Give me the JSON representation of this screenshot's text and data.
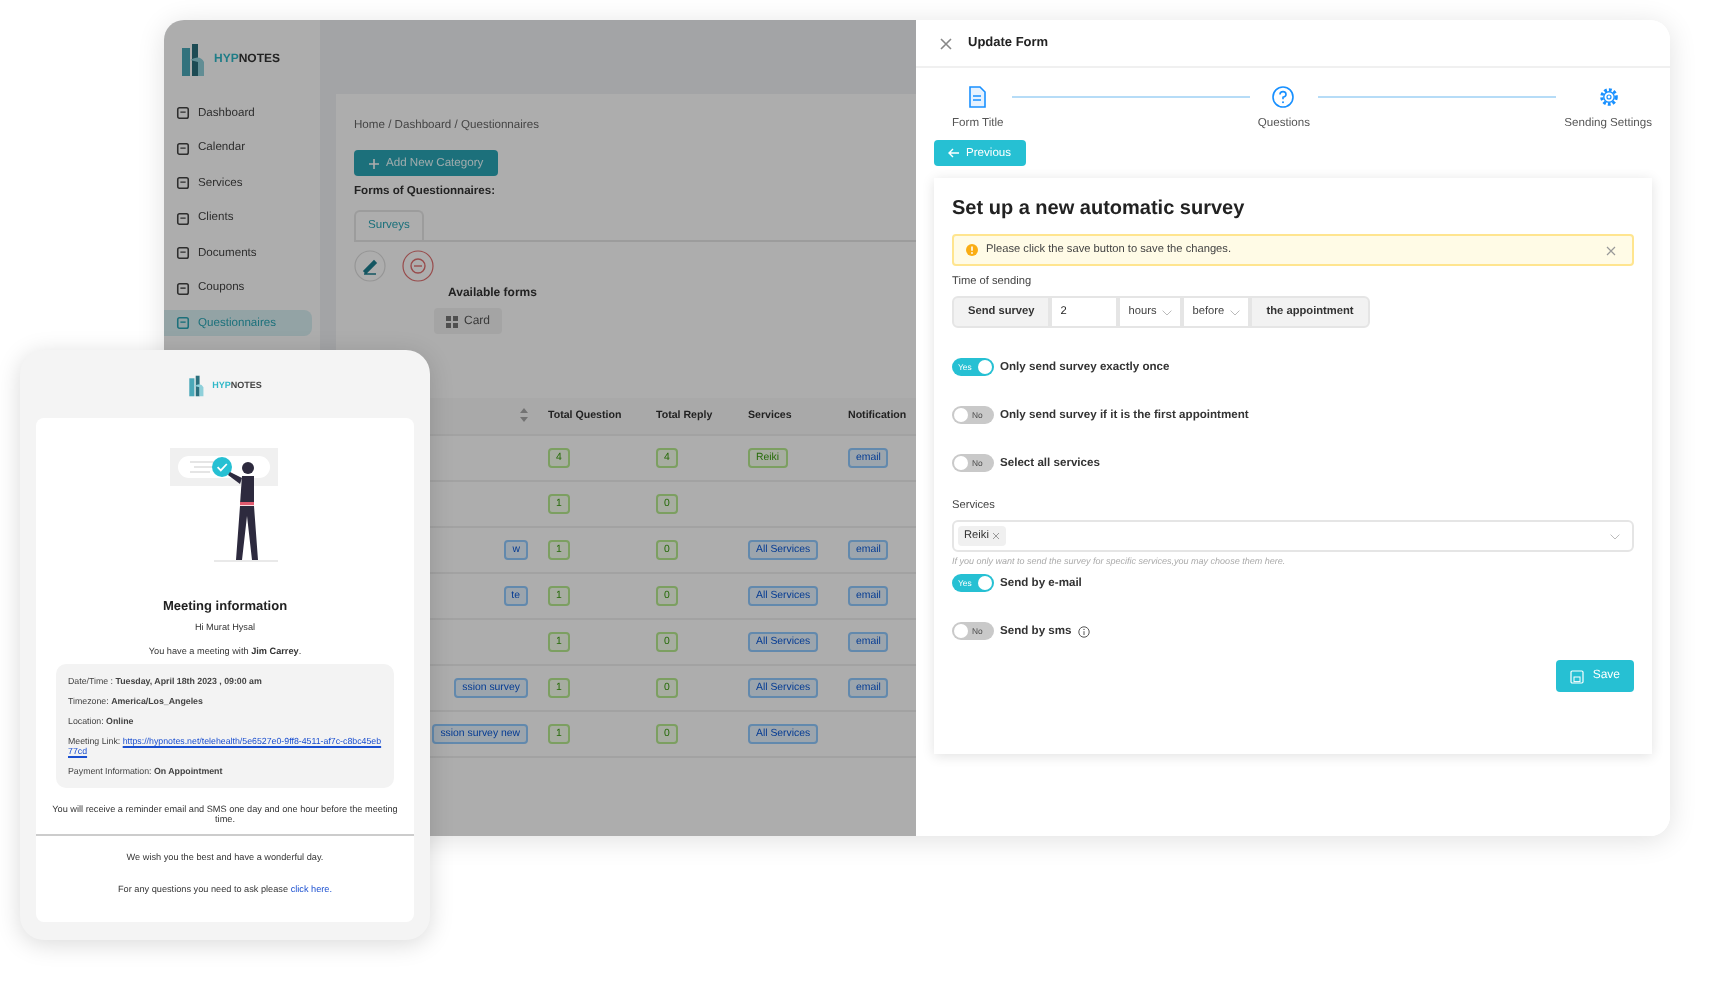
{
  "app": {
    "logo_parts": [
      "HYP",
      "NOTES"
    ],
    "sidebar": {
      "items": [
        {
          "label": "Dashboard",
          "selected": false
        },
        {
          "label": "Calendar",
          "selected": false
        },
        {
          "label": "Services",
          "selected": false
        },
        {
          "label": "Clients",
          "selected": false
        },
        {
          "label": "Documents",
          "selected": false
        },
        {
          "label": "Coupons",
          "selected": false
        },
        {
          "label": "Questionnaires",
          "selected": true
        }
      ]
    },
    "breadcrumb": "Home / Dashboard / Questionnaires",
    "add_button": "Add New Category",
    "forms_label": "Forms of Questionnaires:",
    "category_tabs": [
      {
        "label": "Surveys",
        "selected": true
      }
    ],
    "available_forms": "Available forms",
    "view_toggle": "Card",
    "table": {
      "columns": [
        "Total Question",
        "Total Reply",
        "Services",
        "Notification"
      ],
      "rows": [
        {
          "questions": "4",
          "replies": "4",
          "services": "Reiki",
          "notification": "email"
        },
        {
          "questions": "1",
          "replies": "0"
        },
        {
          "title": "w",
          "questions": "1",
          "replies": "0",
          "services": "All Services",
          "notification": "email"
        },
        {
          "title": "te",
          "questions": "1",
          "replies": "0",
          "services": "All Services",
          "notification": "email"
        },
        {
          "questions": "1",
          "replies": "0",
          "services": "All Services",
          "notification": "email"
        },
        {
          "title": "ssion survey",
          "questions": "1",
          "replies": "0",
          "services": "All Services",
          "notification": "email"
        },
        {
          "title": "ssion survey new",
          "questions": "1",
          "replies": "0",
          "services": "All Services"
        }
      ]
    }
  },
  "drawer": {
    "title": "Update Form",
    "steps": [
      {
        "label": "Form Title",
        "kind": "document"
      },
      {
        "label": "Questions",
        "kind": "question"
      },
      {
        "label": "Sending Settings",
        "kind": "gear"
      }
    ],
    "previous_button": "Previous",
    "card": {
      "title": "Set up a new automatic survey",
      "alert": "Please click the save button to save the changes.",
      "time_label": "Time of sending",
      "time_group": {
        "prefix": "Send survey",
        "amount": "2",
        "unit": "hours",
        "relation": "before",
        "suffix": "the appointment"
      },
      "settings": [
        {
          "kind": "toggle",
          "label": "Only send survey exactly once",
          "on": true,
          "switch_text": "Yes"
        },
        {
          "kind": "toggle",
          "label": "Only send survey if it is the first appointment",
          "on": false,
          "switch_text": "No"
        },
        {
          "kind": "toggle",
          "label": "Select all services",
          "on": false,
          "switch_text": "No"
        },
        {
          "kind": "services",
          "label": "Services",
          "tags": [
            "Reiki"
          ],
          "hint": "If you only want to send the survey for specific services,you may choose them here."
        },
        {
          "kind": "toggle",
          "label": "Send by e-mail",
          "on": true,
          "switch_text": "Yes"
        },
        {
          "kind": "toggle",
          "label": "Send by sms",
          "on": false,
          "switch_text": "No",
          "info": true
        }
      ],
      "save_button": "Save"
    }
  },
  "email": {
    "logo_parts": [
      "HYP",
      "NOTES"
    ],
    "title": "Meeting information",
    "greeting": "Hi Murat Hysal",
    "intro": "You have a meeting with **Jim Carrey**.",
    "details": [
      {
        "text": "Date/Time : **Tuesday, April 18th 2023 , 09:00 am**"
      },
      {
        "text": "Timezone: **America/Los_Angeles**"
      },
      {
        "text": "Location: **Online**"
      },
      {
        "text": "Meeting Link:",
        "link": "https://hypnotes.net/telehealth/5e6527e0-9ff8-4511-af7c-c8bc45eb77cd"
      },
      {
        "text": "Payment Information: **On Appointment**"
      }
    ],
    "reminder": "You will receive a reminder email and SMS one day and one hour before the meeting time.",
    "wish": "We wish you the best and have a wonderful day.",
    "questions": {
      "text": "For any questions you need to ask please",
      "link": "click here."
    }
  }
}
